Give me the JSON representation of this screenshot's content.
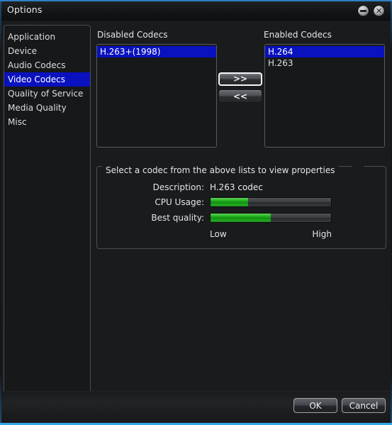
{
  "window": {
    "title": "Options",
    "minimize_icon": "minimize-icon",
    "close_icon": "close-icon",
    "close_glyph": "✕"
  },
  "sidebar": {
    "items": [
      {
        "label": "Application",
        "selected": false
      },
      {
        "label": "Device",
        "selected": false
      },
      {
        "label": "Audio Codecs",
        "selected": false
      },
      {
        "label": "Video Codecs",
        "selected": true
      },
      {
        "label": "Quality of Service",
        "selected": false
      },
      {
        "label": "Media Quality",
        "selected": false
      },
      {
        "label": "Misc",
        "selected": false
      }
    ]
  },
  "main": {
    "disabled_label": "Disabled Codecs",
    "enabled_label": "Enabled Codecs",
    "disabled_codecs": [
      {
        "label": "H.263+(1998)",
        "selected": true
      }
    ],
    "enabled_codecs": [
      {
        "label": "H.264",
        "selected": true
      },
      {
        "label": "H.263",
        "selected": false
      }
    ],
    "add_button": ">>",
    "remove_button": "<<"
  },
  "properties": {
    "group_title": "Select a codec from the above lists to view properties",
    "description_label": "Description:",
    "description_value": "H.263 codec",
    "cpu_label": "CPU Usage:",
    "cpu_percent": 31,
    "quality_label": "Best quality:",
    "quality_percent": 50,
    "scale_low": "Low",
    "scale_high": "High"
  },
  "footer": {
    "ok_label": "OK",
    "cancel_label": "Cancel"
  },
  "colors": {
    "selection": "#0a11bf",
    "meter_fill": "#1ea81c",
    "window_accent": "#35a8e8"
  }
}
